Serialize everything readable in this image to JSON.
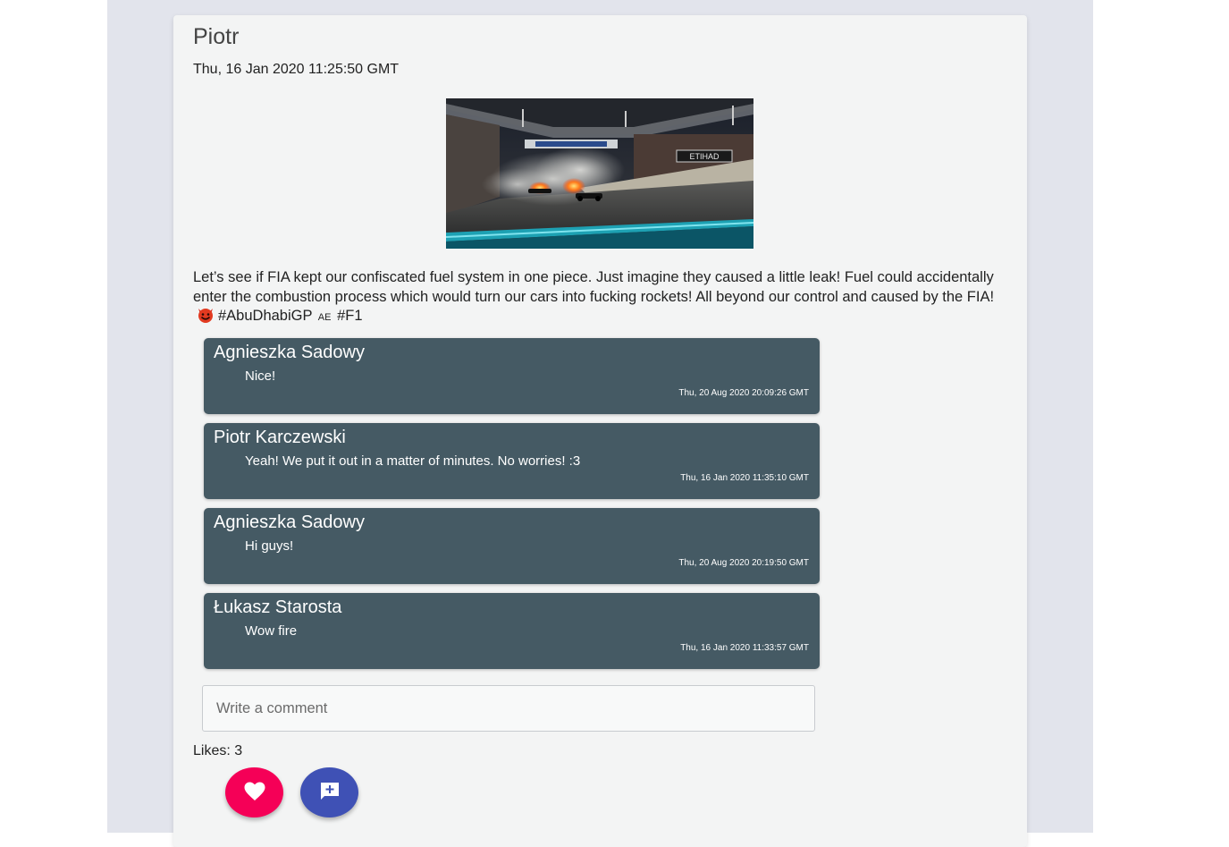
{
  "post": {
    "author": "Piotr",
    "date": "Thu, 16 Jan 2020 11:25:50 GMT",
    "text_before_emoji": "Let’s see if FIA kept our confiscated fuel system in one piece. Just imagine they caused a little leak! Fuel could accidentally enter the combustion process which would turn our cars into fucking rockets! All beyond our control and caused by the FIA!",
    "hashtag_1": "#AbuDhabiGP",
    "flag_label": "AE",
    "hashtag_2": "#F1",
    "image_sign_text": "ETIHAD",
    "emoji_icon": "smiling-devil-icon"
  },
  "comments": [
    {
      "author": "Agnieszka Sadowy",
      "text": "Nice!",
      "date": "Thu, 20 Aug 2020 20:09:26 GMT"
    },
    {
      "author": "Piotr Karczewski",
      "text": "Yeah! We put it out in a matter of minutes. No worries! :3",
      "date": "Thu, 16 Jan 2020 11:35:10 GMT"
    },
    {
      "author": "Agnieszka Sadowy",
      "text": "Hi guys!",
      "date": "Thu, 20 Aug 2020 20:19:50 GMT"
    },
    {
      "author": "Łukasz Starosta",
      "text": "Wow fire",
      "date": "Thu, 16 Jan 2020 11:33:57 GMT"
    }
  ],
  "comment_input": {
    "placeholder": "Write a comment",
    "value": ""
  },
  "likes": {
    "label": "Likes: 3"
  },
  "buttons": {
    "like_icon": "heart-icon",
    "add_comment_icon": "add-comment-icon"
  },
  "colors": {
    "page_background": "#e2e4ec",
    "card_background": "#f3f4f4",
    "comment_background": "#455a64",
    "like_button": "#f50057",
    "add_comment_button": "#3f51b5"
  }
}
